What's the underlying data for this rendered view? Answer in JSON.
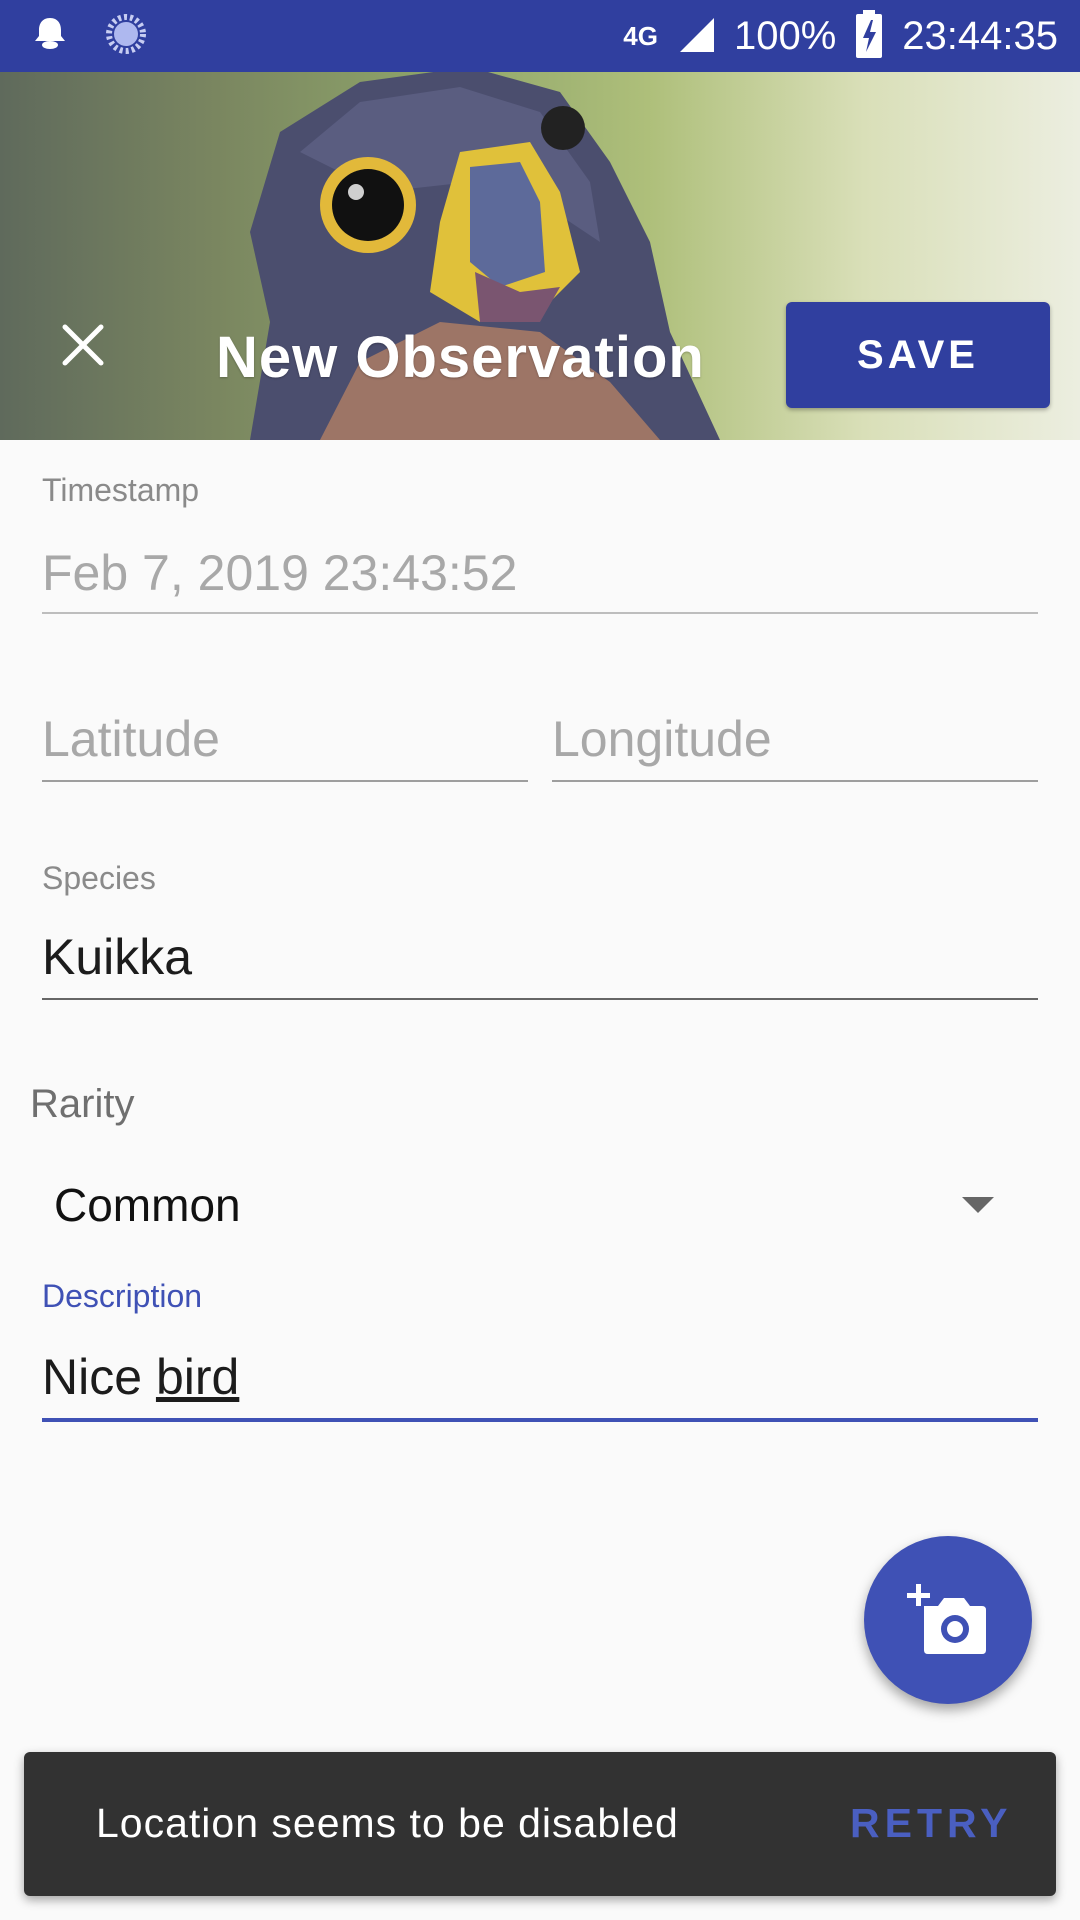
{
  "status_bar": {
    "network": "4G",
    "battery": "100%",
    "time": "23:44:35"
  },
  "header": {
    "title": "New Observation",
    "save_label": "SAVE"
  },
  "form": {
    "timestamp": {
      "label": "Timestamp",
      "value": "Feb 7, 2019 23:43:52"
    },
    "latitude": {
      "placeholder": "Latitude"
    },
    "longitude": {
      "placeholder": "Longitude"
    },
    "species": {
      "label": "Species",
      "value": "Kuikka"
    },
    "rarity": {
      "label": "Rarity",
      "selected": "Common"
    },
    "description": {
      "label": "Description",
      "value_word1": "Nice",
      "value_word2": "bird"
    }
  },
  "snackbar": {
    "message": "Location seems to be disabled",
    "action": "RETRY"
  },
  "colors": {
    "primary": "#303f9f",
    "accent": "#3f51b5",
    "snackbar": "#323232"
  },
  "icons": [
    "notification-icon",
    "sync-icon",
    "signal-icon",
    "battery-charging-icon",
    "close-icon",
    "add-photo-icon",
    "dropdown-arrow-icon"
  ]
}
